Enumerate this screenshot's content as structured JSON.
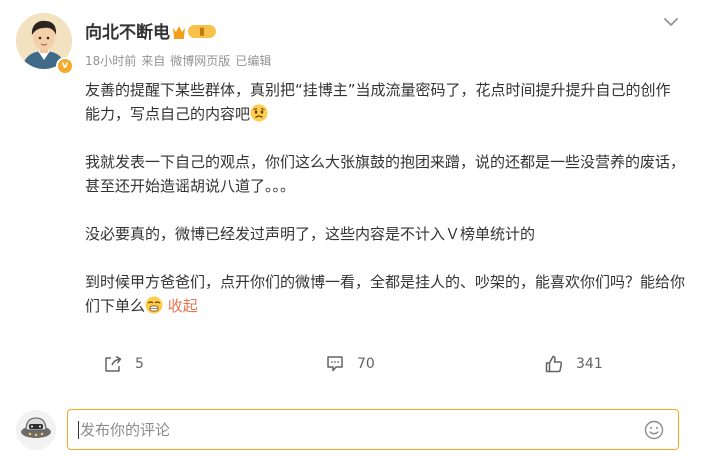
{
  "post": {
    "author": "向北不断电",
    "vip_level": "Ⅱ",
    "verified_badge": "v",
    "time": "18小时前",
    "source_prefix": "来自",
    "source": "微博网页版",
    "edited": "已编辑",
    "paragraphs": [
      {
        "text": "友善的提醒下某些群体，真别把“挂博主”当成流量密码了，花点时间提升提升自己的创作能力，写点自己的内容吧",
        "emoji": "sad-face-emoji"
      },
      {
        "text": "我就发表一下自己的观点，你们这么大张旗鼓的抱团来蹭，说的还都是一些没营养的废话，甚至还开始造谣胡说八道了。。。",
        "emoji": null
      },
      {
        "text": "没必要真的，微博已经发过声明了，这些内容是不计入Ｖ榜单统计的",
        "emoji": null
      },
      {
        "text": "到时候甲方爸爸们，点开你们的微博一看，全都是挂人的、吵架的，能喜欢你们吗？能给你们下单么",
        "emoji": "shocked-face-emoji"
      }
    ],
    "collapse_label": "收起"
  },
  "actions": {
    "share_count": "5",
    "comment_count": "70",
    "like_count": "341"
  },
  "comment": {
    "placeholder": "发布你的评论"
  },
  "colors": {
    "accent": "#eb7350",
    "input_border": "#f5a623",
    "meta_gray": "#939393"
  }
}
